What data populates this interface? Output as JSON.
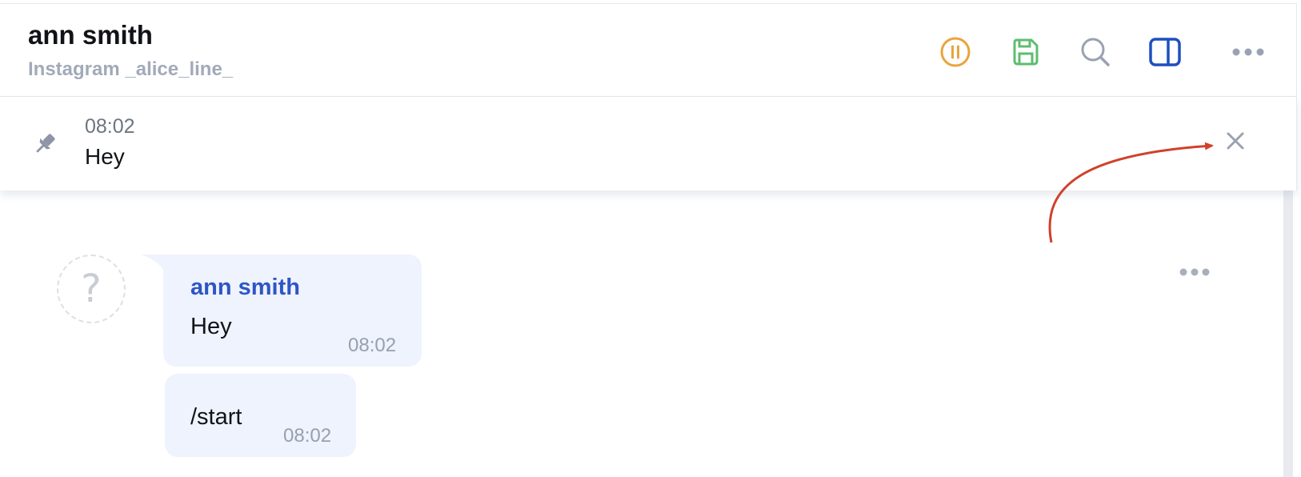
{
  "header": {
    "contact_name": "ann smith",
    "contact_source": "Instagram _alice_line_",
    "actions": [
      {
        "name": "pause-icon",
        "color": "#e9a43b"
      },
      {
        "name": "save-icon",
        "color": "#5dbd6f"
      },
      {
        "name": "search-icon",
        "color": "#9aa2b1"
      },
      {
        "name": "sidebar-toggle-icon",
        "color": "#1f4fbf"
      },
      {
        "name": "more-icon",
        "color": "#9aa2b1"
      }
    ]
  },
  "pinned": {
    "icon": "pin-icon",
    "time": "08:02",
    "text": "Hey",
    "close_icon": "close-icon"
  },
  "messages": [
    {
      "avatar": "?",
      "sender": "ann smith",
      "text": "Hey",
      "time": "08:02"
    },
    {
      "text": "/start",
      "time": "08:02"
    }
  ],
  "colors": {
    "accent": "#2f55c6",
    "bubble": "#eef3fd",
    "muted": "#98a0ae",
    "annotation_arrow": "#d0412a"
  }
}
